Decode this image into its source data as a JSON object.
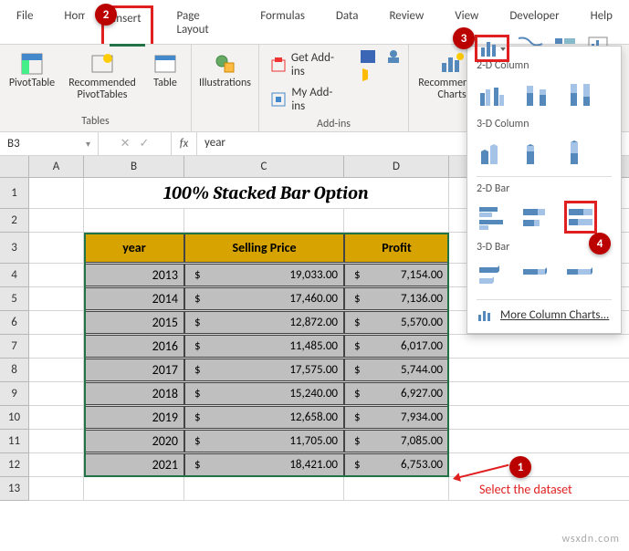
{
  "tabs": [
    "File",
    "Home",
    "Insert",
    "Page Layout",
    "Formulas",
    "Data",
    "Review",
    "View",
    "Developer",
    "Help"
  ],
  "activeTab": "Insert",
  "ribbon": {
    "tables": {
      "pivot": "PivotTable",
      "recommended": "Recommended\nPivotTables",
      "table": "Table",
      "label": "Tables"
    },
    "illustrations": "Illustrations",
    "addins": {
      "get": "Get Add-ins",
      "my": "My Add-ins",
      "label": "Add-ins"
    },
    "charts": {
      "recommended": "Recommended\nCharts"
    }
  },
  "namebox": "B3",
  "formula": "year",
  "columns": [
    "A",
    "B",
    "C",
    "D"
  ],
  "title": "100% Stacked Bar Option",
  "headers": {
    "b": "year",
    "c": "Selling Price",
    "d": "Profit"
  },
  "rows": [
    {
      "year": "2013",
      "price": "19,033.00",
      "profit": "7,154.00"
    },
    {
      "year": "2014",
      "price": "17,460.00",
      "profit": "7,136.00"
    },
    {
      "year": "2015",
      "price": "12,872.00",
      "profit": "5,570.00"
    },
    {
      "year": "2016",
      "price": "11,485.00",
      "profit": "6,017.00"
    },
    {
      "year": "2017",
      "price": "17,575.00",
      "profit": "5,744.00"
    },
    {
      "year": "2018",
      "price": "15,240.00",
      "profit": "6,927.00"
    },
    {
      "year": "2019",
      "price": "12,658.00",
      "profit": "7,934.00"
    },
    {
      "year": "2020",
      "price": "11,705.00",
      "profit": "7,085.00"
    },
    {
      "year": "2021",
      "price": "18,421.00",
      "profit": "6,753.00"
    }
  ],
  "dropdown": {
    "h1": "2-D Column",
    "h2": "3-D Column",
    "h3": "2-D Bar",
    "h4": "3-D Bar",
    "more": "More Column Charts..."
  },
  "callouts": {
    "select": "Select the dataset"
  },
  "watermark": "wsxdn.com",
  "currency": "$"
}
